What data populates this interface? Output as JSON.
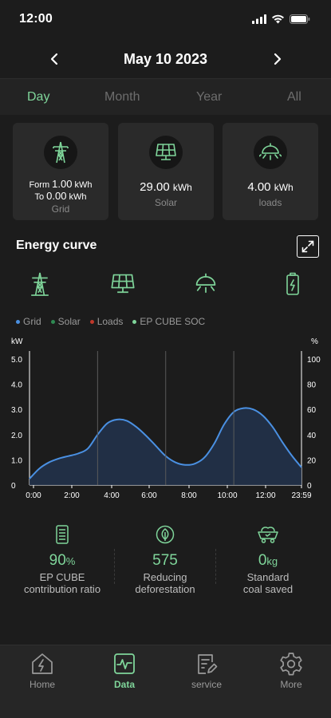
{
  "status_bar": {
    "time": "12:00"
  },
  "date_nav": {
    "title": "May 10 2023"
  },
  "period_tabs": [
    {
      "label": "Day",
      "active": true
    },
    {
      "label": "Month",
      "active": false
    },
    {
      "label": "Year",
      "active": false
    },
    {
      "label": "All",
      "active": false
    }
  ],
  "cards": {
    "grid": {
      "from_prefix": "Form",
      "from_value": "1.00",
      "from_unit": "kWh",
      "to_prefix": "To",
      "to_value": "0.00",
      "to_unit": "kWh",
      "label": "Grid",
      "icon": "power-tower-icon"
    },
    "solar": {
      "value": "29.00",
      "unit": "kWh",
      "label": "Solar",
      "icon": "solar-panel-icon"
    },
    "loads": {
      "value": "4.00",
      "unit": "kWh",
      "label": "loads",
      "icon": "ceiling-lamp-icon"
    }
  },
  "energy_curve": {
    "title": "Energy curve",
    "icons": [
      "power-tower-icon",
      "solar-panel-icon",
      "ceiling-lamp-icon",
      "battery-icon"
    ]
  },
  "legend": [
    {
      "label": "Grid",
      "color": "#4a90e2"
    },
    {
      "label": "Solar",
      "color": "#2f8a52"
    },
    {
      "label": "Loads",
      "color": "#c0392b"
    },
    {
      "label": "EP CUBE SOC",
      "color": "#7fd59a"
    }
  ],
  "chart_data": {
    "type": "area",
    "y_left_label": "kW",
    "y_right_label": "%",
    "y_left_ticks": [
      "5.0",
      "4.0",
      "3.0",
      "2.0",
      "1.0",
      "0"
    ],
    "y_right_ticks": [
      "100",
      "80",
      "60",
      "40",
      "20",
      "0"
    ],
    "y_left_range": [
      0,
      5
    ],
    "y_right_range": [
      0,
      100
    ],
    "x_ticks": [
      "0:00",
      "2:00",
      "4:00",
      "6:00",
      "8:00",
      "10:00",
      "12:00",
      "23:59"
    ],
    "series": [
      {
        "name": "Grid",
        "color": "#4a90e2",
        "x": [
          0,
          0.5,
          1,
          1.5,
          2,
          2.5,
          3,
          3.5,
          4,
          4.5,
          5,
          5.5,
          6,
          6.5,
          7,
          7.5,
          8,
          8.5,
          9,
          9.5,
          10,
          10.5,
          11,
          11.5,
          12,
          12.5,
          13,
          13.5,
          13.98
        ],
        "y": [
          0.25,
          0.65,
          0.9,
          1.05,
          1.15,
          1.25,
          1.45,
          2.0,
          2.45,
          2.6,
          2.55,
          2.3,
          1.95,
          1.55,
          1.15,
          0.9,
          0.8,
          0.85,
          1.1,
          1.65,
          2.4,
          2.9,
          3.05,
          3.0,
          2.75,
          2.3,
          1.7,
          1.15,
          0.7
        ]
      }
    ],
    "grid": false,
    "vertical_markers_x": [
      3.5,
      7,
      10.5
    ]
  },
  "stats": [
    {
      "value": "90",
      "unit": "%",
      "label_line1": "EP CUBE",
      "label_line2": "contribution ratio",
      "icon": "battery-cube-icon"
    },
    {
      "value": "575",
      "unit": "",
      "label_line1": "Reducing",
      "label_line2": "deforestation",
      "icon": "leaf-icon"
    },
    {
      "value": "0",
      "unit": "kg",
      "label_line1": "Standard",
      "label_line2": "coal saved",
      "icon": "coal-cart-icon"
    }
  ],
  "bottom_nav": [
    {
      "label": "Home",
      "active": false,
      "icon": "home-bolt-icon"
    },
    {
      "label": "Data",
      "active": true,
      "icon": "chart-pulse-icon"
    },
    {
      "label": "service",
      "active": false,
      "icon": "document-edit-icon"
    },
    {
      "label": "More",
      "active": false,
      "icon": "gear-icon"
    }
  ]
}
